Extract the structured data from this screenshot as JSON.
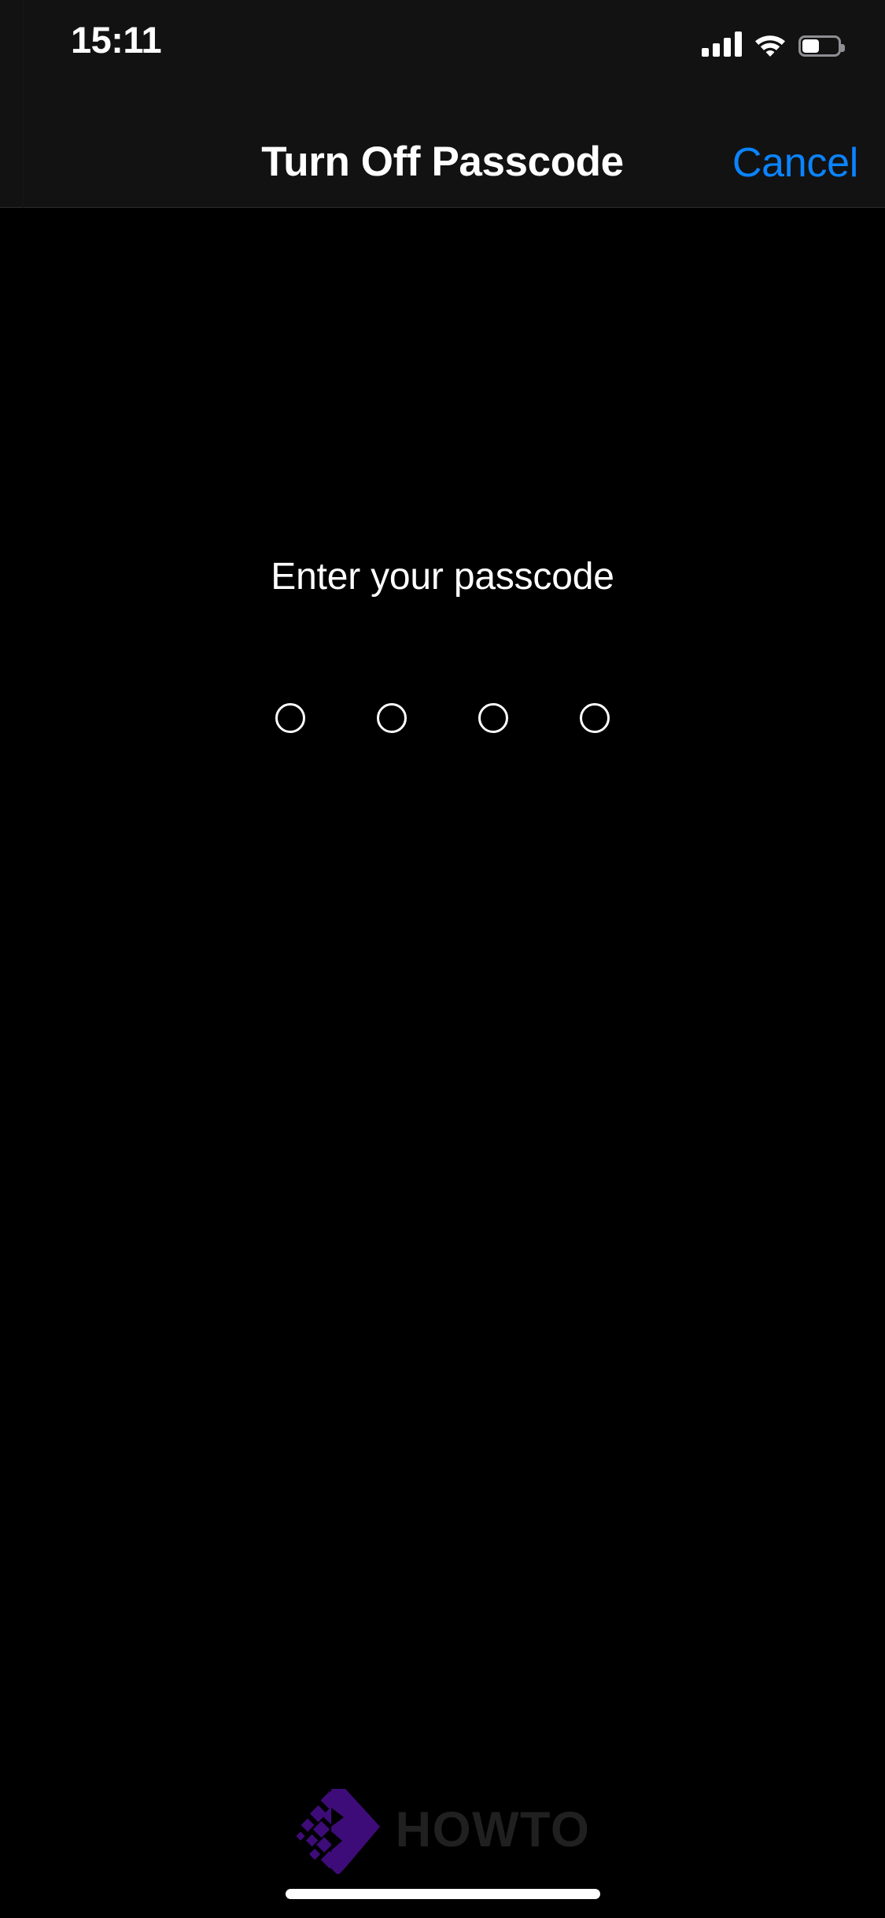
{
  "screen": {
    "background_color": "#000000",
    "nav_background_color": "#121212",
    "accent_color": "#0A84FF"
  },
  "status_bar": {
    "time": "15:11",
    "cellular_icon": "signal-bars-icon",
    "cellular_bars_active": 4,
    "cellular_bars_total": 4,
    "wifi_icon": "wifi-icon",
    "wifi_strength": "full",
    "battery_icon": "battery-icon",
    "battery_percent": 48,
    "battery_fill_color": "#FFFFFF",
    "battery_outline_color": "#8E8E93"
  },
  "nav_bar": {
    "title": "Turn Off Passcode",
    "cancel_label": "Cancel",
    "cancel_color": "#0A84FF"
  },
  "passcode": {
    "prompt": "Enter your passcode",
    "digits_total": 4,
    "digits_entered": 0,
    "dots": [
      {
        "filled": false
      },
      {
        "filled": false
      },
      {
        "filled": false
      },
      {
        "filled": false
      }
    ]
  },
  "watermark": {
    "text": "HOWTO",
    "logo_icon": "pixelated-diamond-logo-icon",
    "logo_color": "#3E0C78",
    "text_color": "#202020"
  },
  "home_indicator": {
    "label": "home-indicator",
    "color": "#FFFFFF"
  }
}
